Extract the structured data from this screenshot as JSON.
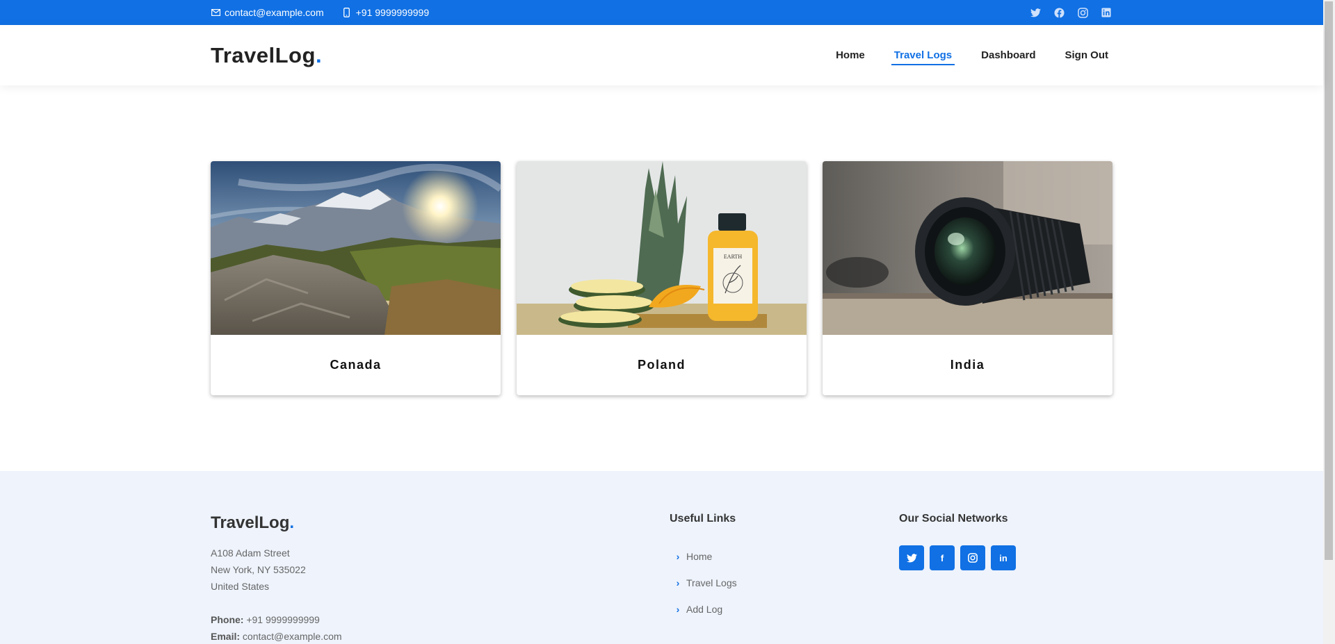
{
  "topbar": {
    "email": "contact@example.com",
    "phone": "+91 9999999999",
    "social_icons": [
      "twitter-icon",
      "facebook-icon",
      "instagram-icon",
      "linkedin-icon"
    ]
  },
  "header": {
    "logo_text": "TravelLog",
    "logo_dot": ".",
    "nav": [
      {
        "label": "Home",
        "active": false
      },
      {
        "label": "Travel Logs",
        "active": true
      },
      {
        "label": "Dashboard",
        "active": false
      },
      {
        "label": "Sign Out",
        "active": false
      }
    ]
  },
  "cards": [
    {
      "title": "Canada",
      "image": "mountain-sunset-image"
    },
    {
      "title": "Poland",
      "image": "pineapple-juice-image"
    },
    {
      "title": "India",
      "image": "camera-lens-image"
    }
  ],
  "footer": {
    "logo_text": "TravelLog",
    "logo_dot": ".",
    "address": [
      "A108 Adam Street",
      "New York, NY 535022",
      "United States"
    ],
    "phone_label": "Phone:",
    "phone": "+91 9999999999",
    "email_label": "Email:",
    "email": "contact@example.com",
    "useful_links_title": "Useful Links",
    "useful_links": [
      "Home",
      "Travel Logs",
      "Add Log"
    ],
    "social_title": "Our Social Networks",
    "social_buttons": [
      {
        "icon": "twitter-icon",
        "glyph": ""
      },
      {
        "icon": "facebook-icon",
        "glyph": "f"
      },
      {
        "icon": "instagram-icon",
        "glyph": ""
      },
      {
        "icon": "linkedin-icon",
        "glyph": "in"
      }
    ]
  },
  "colors": {
    "accent": "#1070e4",
    "footer_bg": "#eef3fc"
  }
}
